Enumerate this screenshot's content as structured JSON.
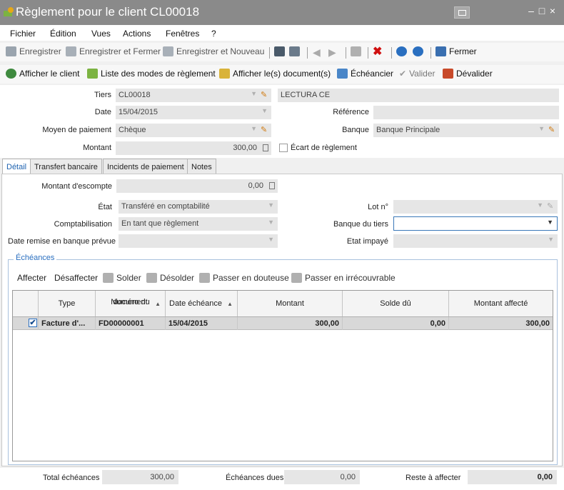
{
  "window": {
    "title": "Règlement pour le client CL00018"
  },
  "menu": [
    "Fichier",
    "Édition",
    "Vues",
    "Actions",
    "Fenêtres",
    "?"
  ],
  "toolbar1": {
    "save": "Enregistrer",
    "save_close": "Enregistrer et Fermer",
    "save_new": "Enregistrer et Nouveau",
    "close": "Fermer"
  },
  "toolbar2": {
    "show_client": "Afficher le client",
    "payment_modes": "Liste des modes de règlement",
    "show_documents": "Afficher le(s) document(s)",
    "schedule": "Échéancier",
    "validate": "Valider",
    "unvalidate": "Dévalider"
  },
  "header": {
    "tiers_label": "Tiers",
    "tiers_value": "CL00018",
    "tiers_name": "LECTURA CE",
    "date_label": "Date",
    "date_value": "15/04/2015",
    "reference_label": "Référence",
    "reference_value": "",
    "payment_method_label": "Moyen de paiement",
    "payment_method_value": "Chèque",
    "bank_label": "Banque",
    "bank_value": "Banque Principale",
    "amount_label": "Montant",
    "amount_value": "300,00",
    "gap_label": "Écart de règlement",
    "gap_checked": false
  },
  "tabs": [
    "Détail",
    "Transfert bancaire",
    "Incidents de paiement",
    "Notes"
  ],
  "detail": {
    "discount_label": "Montant d'escompte",
    "discount_value": "0,00",
    "state_label": "État",
    "state_value": "Transféré en comptabilité",
    "lot_label": "Lot n°",
    "lot_value": "",
    "accounting_label": "Comptabilisation",
    "accounting_value": "En tant que règlement",
    "third_bank_label": "Banque du tiers",
    "third_bank_value": "",
    "bank_date_label": "Date remise en banque prévue",
    "bank_date_value": "",
    "unpaid_label": "Etat impayé",
    "unpaid_value": ""
  },
  "schedules": {
    "title": "Échéances",
    "tools": {
      "assign": "Affecter",
      "unassign": "Désaffecter",
      "settle": "Solder",
      "unsettle": "Désolder",
      "doubtful": "Passer en douteuse",
      "unrecoverable": "Passer en irrécouvrable"
    },
    "columns": {
      "type": "Type",
      "doc_number_1": "Numéro du",
      "doc_number_2": "document",
      "due_date": "Date échéance",
      "amount": "Montant",
      "balance": "Solde dû",
      "assigned": "Montant affecté"
    },
    "rows": [
      {
        "checked": true,
        "type": "Facture d'...",
        "doc_number": "FD00000001",
        "due_date": "15/04/2015",
        "amount": "300,00",
        "balance": "0,00",
        "assigned": "300,00"
      }
    ]
  },
  "footer": {
    "total_label": "Total échéances",
    "total_value": "300,00",
    "due_label": "Échéances dues",
    "due_value": "0,00",
    "remaining_label": "Reste à affecter",
    "remaining_value": "0,00"
  },
  "colors": {
    "accent": "#1d62b0",
    "titlebar": "#8a8a8a",
    "delete": "#d01010"
  }
}
